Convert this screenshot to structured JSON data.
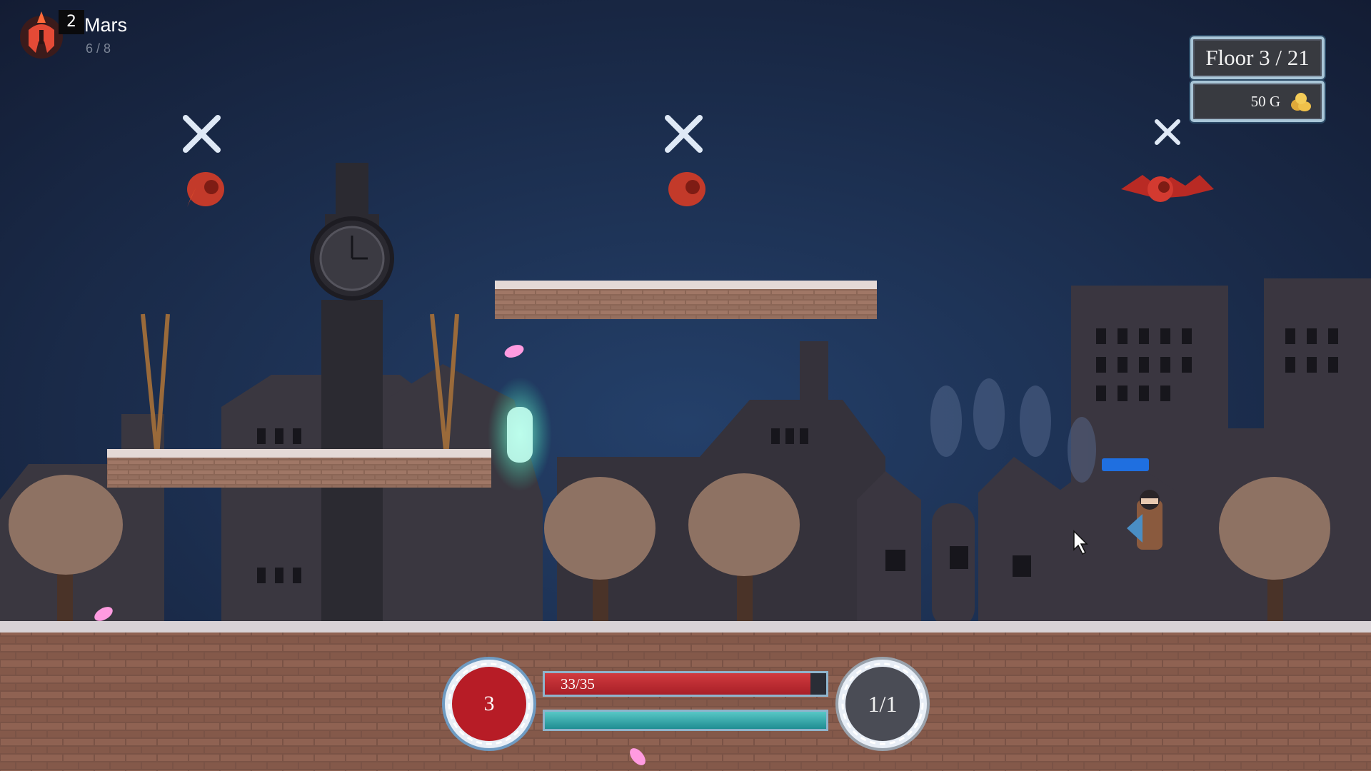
{
  "god": {
    "level": "2",
    "name": "Mars",
    "progress": "6 / 8",
    "emblem_icon": "spartan-helmet-icon"
  },
  "floor": {
    "label": "Floor 3 / 21"
  },
  "gold": {
    "label": "50 G",
    "icon": "gold-coins-icon"
  },
  "hud": {
    "skill_charges": "3",
    "health_text": "33/35",
    "health_fraction": 0.943,
    "mana_fraction": 1.0,
    "dash_charges": "1/1"
  },
  "colors": {
    "sky": "#1b2a4a",
    "health": "#c22a32",
    "mana": "#3fb2b4",
    "frame": "#a9c6d8",
    "enemy": "#c33a2a"
  },
  "enemies": [
    {
      "type": "flame-imp",
      "marker": "crossed-swords-icon"
    },
    {
      "type": "flame-imp",
      "marker": "crossed-swords-icon"
    },
    {
      "type": "bat",
      "marker": "crossed-swords-icon"
    }
  ]
}
